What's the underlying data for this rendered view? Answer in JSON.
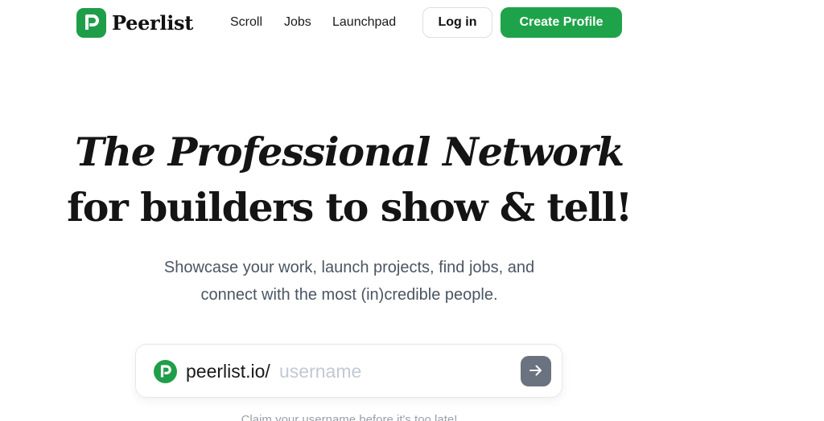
{
  "header": {
    "logo_text": "Peerlist",
    "logo_icon": "peerlist-logo-icon",
    "nav": [
      {
        "label": "Scroll"
      },
      {
        "label": "Jobs"
      },
      {
        "label": "Launchpad"
      }
    ],
    "login_label": "Log in",
    "create_profile_label": "Create Profile"
  },
  "hero": {
    "title_line1": "The Professional Network",
    "title_line2": "for builders to show & tell!",
    "subtitle_line1": "Showcase your work, launch projects, find jobs, and",
    "subtitle_line2": "connect with the most (in)credible people."
  },
  "claim": {
    "prefix": "peerlist.io/",
    "placeholder": "username",
    "value": "",
    "submit_icon": "arrow-right-icon"
  },
  "footnote": "Claim your username before it's too late!",
  "colors": {
    "brand_green": "#1fa34a",
    "submit_gray": "#6b7280",
    "text_muted": "#4b5563",
    "placeholder": "#c3c9d4"
  }
}
